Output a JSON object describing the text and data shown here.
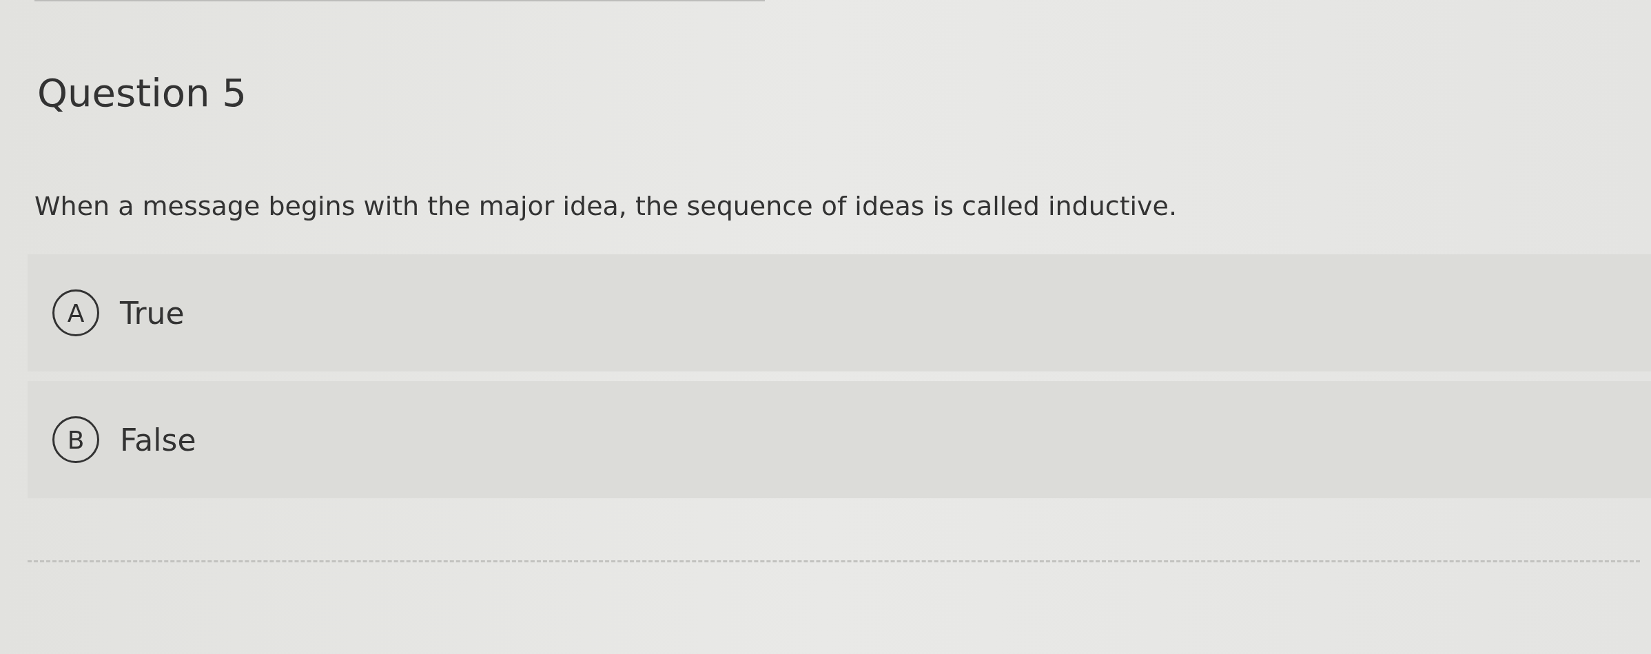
{
  "question": {
    "title": "Question 5",
    "prompt": "When a message begins with the major idea, the sequence of ideas is called inductive.",
    "options": [
      {
        "letter": "A",
        "text": "True"
      },
      {
        "letter": "B",
        "text": "False"
      }
    ]
  }
}
